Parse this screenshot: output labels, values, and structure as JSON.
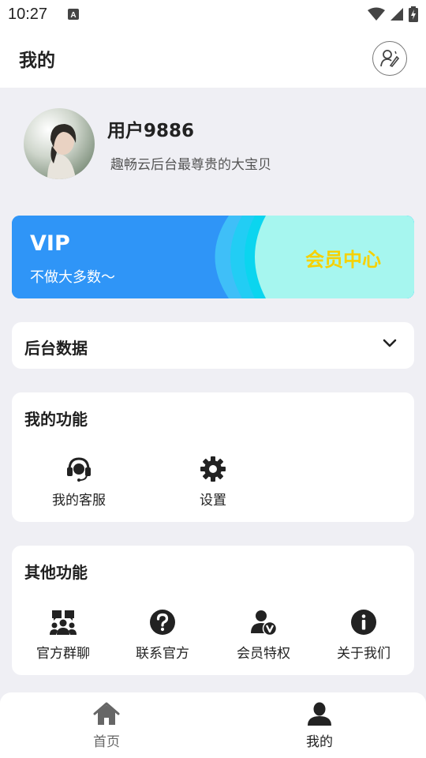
{
  "status_bar": {
    "time": "10:27"
  },
  "header": {
    "title": "我的"
  },
  "profile": {
    "username": "用户9886",
    "motto": "趣畅云后台最尊贵的大宝贝"
  },
  "vip_card": {
    "title": "VIP",
    "subtitle": "不做大多数～",
    "action_label": "会员中心"
  },
  "backend_section": {
    "title": "后台数据"
  },
  "my_functions": {
    "title": "我的功能",
    "items": [
      {
        "label": "我的客服",
        "icon": "headset-icon"
      },
      {
        "label": "设置",
        "icon": "gear-icon"
      }
    ]
  },
  "other_functions": {
    "title": "其他功能",
    "items": [
      {
        "label": "官方群聊",
        "icon": "group-chat-icon"
      },
      {
        "label": "联系官方",
        "icon": "question-icon"
      },
      {
        "label": "会员特权",
        "icon": "vip-user-icon"
      },
      {
        "label": "关于我们",
        "icon": "info-icon"
      }
    ]
  },
  "bottom_nav": {
    "items": [
      {
        "label": "首页",
        "icon": "home-icon",
        "active": false
      },
      {
        "label": "我的",
        "icon": "user-icon",
        "active": true
      }
    ]
  },
  "colors": {
    "page_bg": "#efeff4",
    "vip_blue": "#2f95f7",
    "vip_gold": "#f6d100",
    "vip_mint": "#a6f6ef",
    "nav_inactive": "#666666",
    "nav_active": "#222222"
  }
}
